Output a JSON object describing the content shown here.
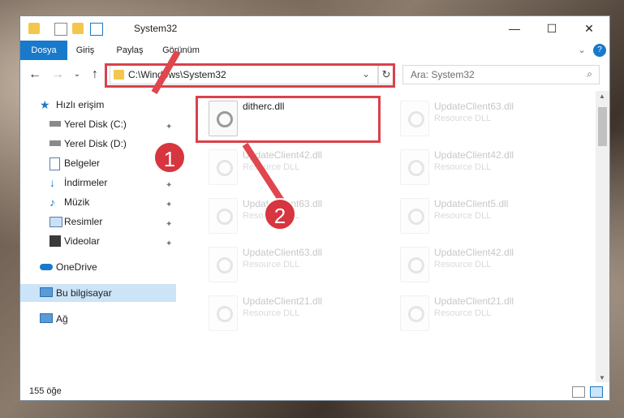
{
  "window": {
    "title": "System32"
  },
  "ribbon": {
    "tabs": [
      {
        "label": "Dosya"
      },
      {
        "label": "Giriş"
      },
      {
        "label": "Paylaş"
      },
      {
        "label": "Görünüm"
      }
    ]
  },
  "address": {
    "path": "C:\\Windows\\System32"
  },
  "search": {
    "placeholder": "Ara: System32"
  },
  "sidebar": {
    "items": [
      {
        "label": "Hızlı erişim"
      },
      {
        "label": "Yerel Disk (C:)"
      },
      {
        "label": "Yerel Disk (D:)"
      },
      {
        "label": "Belgeler"
      },
      {
        "label": "İndirmeler"
      },
      {
        "label": "Müzik"
      },
      {
        "label": "Resimler"
      },
      {
        "label": "Videolar"
      },
      {
        "label": "OneDrive"
      },
      {
        "label": "Bu bilgisayar"
      },
      {
        "label": "Ağ"
      }
    ]
  },
  "files": [
    {
      "name": "ditherc.dll",
      "type": ""
    },
    {
      "name": "UpdateClient63.dll",
      "type": "Resource DLL"
    },
    {
      "name": "UpdateClient42.dll",
      "type": "Resource DLL"
    },
    {
      "name": "UpdateClient42.dll",
      "type": "Resource DLL"
    },
    {
      "name": "UpdateClient63.dll",
      "type": "Resource DLL"
    },
    {
      "name": "UpdateClient5.dll",
      "type": "Resource DLL"
    },
    {
      "name": "UpdateClient63.dll",
      "type": "Resource DLL"
    },
    {
      "name": "UpdateClient42.dll",
      "type": "Resource DLL"
    },
    {
      "name": "UpdateClient21.dll",
      "type": "Resource DLL"
    },
    {
      "name": "UpdateClient21.dll",
      "type": "Resource DLL"
    }
  ],
  "status": {
    "count": "155 öğe"
  },
  "annotations": {
    "badge1": "1",
    "badge2": "2"
  }
}
